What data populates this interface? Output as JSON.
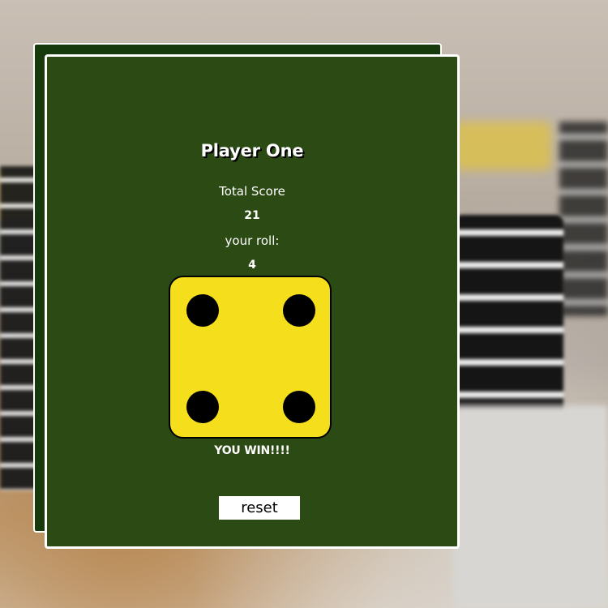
{
  "game": {
    "player_name": "Player One",
    "total_score_label": "Total Score",
    "total_score": "21",
    "roll_label": "your roll:",
    "roll_value": "4",
    "die_face": 4,
    "result_text": "YOU WIN!!!!",
    "reset_label": "reset"
  },
  "colors": {
    "card_green": "#2c4a14",
    "card_back_green": "#173a0c",
    "die_yellow": "#f5df1d",
    "pip_black": "#000000"
  }
}
